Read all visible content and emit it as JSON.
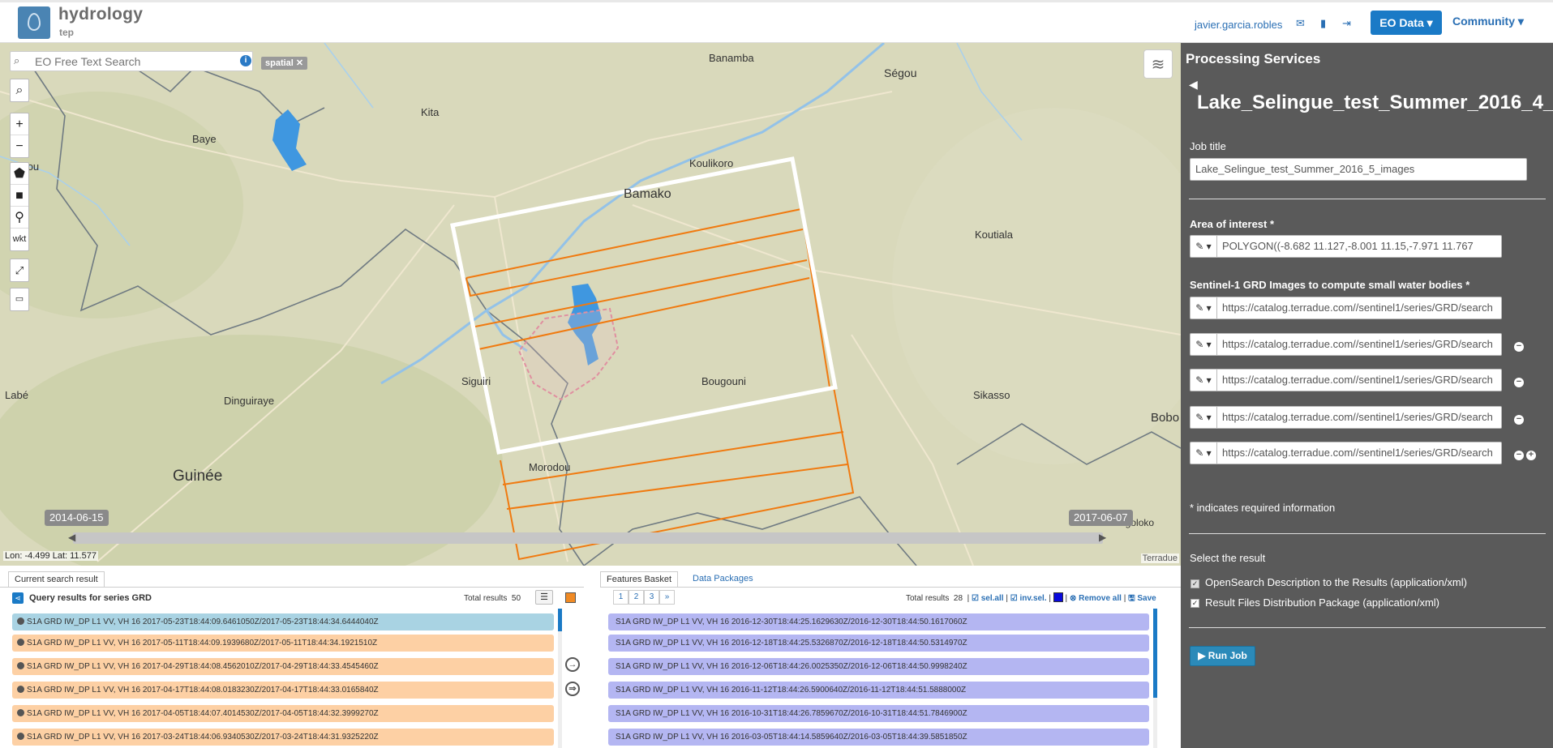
{
  "brand": {
    "title": "hydrology",
    "subtitle": "tep"
  },
  "header": {
    "user": "javier.garcia.robles",
    "eo_data_label": "EO Data",
    "community_label": "Community"
  },
  "map": {
    "search_placeholder": "EO Free Text Search",
    "spatial_tag": "spatial",
    "wkt_label": "wkt",
    "places": {
      "banamba": "Banamba",
      "segou": "Ségou",
      "kita": "Kita",
      "baye": "Baye",
      "koulikoro": "Koulikoro",
      "bamako": "Bamako",
      "koutiala": "Koutiala",
      "bougouni": "Bougouni",
      "siguiri": "Siguiri",
      "dinguiraye": "Dinguiraye",
      "labe": "Labé",
      "sikasso": "Sikasso",
      "bobo": "Bobo",
      "guinee": "Guinée",
      "morodou": "Morodou",
      "niangoloko": "Niangoloko",
      "dougou": "ougou"
    },
    "time_start": "2014-06-15",
    "time_end": "2017-06-07",
    "coords": "Lon: -4.499 Lat: 11.577",
    "attribution": "Terradue"
  },
  "panel": {
    "title": "Processing Services",
    "job_header": "Lake_Selingue_test_Summer_2016_4_",
    "job_title_label": "Job title",
    "job_title_value": "Lake_Selingue_test_Summer_2016_5_images",
    "aoi_label": "Area of interest *",
    "aoi_value": "POLYGON((-8.682 11.127,-8.001 11.15,-7.971 11.767",
    "images_label": "Sentinel-1 GRD Images to compute small water bodies *",
    "image_inputs": [
      "https://catalog.terradue.com//sentinel1/series/GRD/search",
      "https://catalog.terradue.com//sentinel1/series/GRD/search",
      "https://catalog.terradue.com//sentinel1/series/GRD/search",
      "https://catalog.terradue.com//sentinel1/series/GRD/search",
      "https://catalog.terradue.com//sentinel1/series/GRD/search"
    ],
    "required_note": "* indicates required information",
    "select_result_label": "Select the result",
    "result_options": [
      "OpenSearch Description to the Results (application/xml)",
      "Result Files Distribution Package (application/xml)"
    ],
    "run_label": "Run Job"
  },
  "search_results": {
    "tab_label": "Current search result",
    "title": "Query results for series GRD",
    "total_label": "Total results",
    "total": "50",
    "rows": [
      "S1A GRD IW_DP L1 VV, VH 16 2017-05-23T18:44:09.6461050Z/2017-05-23T18:44:34.6444040Z",
      "S1A GRD IW_DP L1 VV, VH 16 2017-05-11T18:44:09.1939680Z/2017-05-11T18:44:34.1921510Z",
      "S1A GRD IW_DP L1 VV, VH 16 2017-04-29T18:44:08.4562010Z/2017-04-29T18:44:33.4545460Z",
      "S1A GRD IW_DP L1 VV, VH 16 2017-04-17T18:44:08.0183230Z/2017-04-17T18:44:33.0165840Z",
      "S1A GRD IW_DP L1 VV, VH 16 2017-04-05T18:44:07.4014530Z/2017-04-05T18:44:32.3999270Z",
      "S1A GRD IW_DP L1 VV, VH 16 2017-03-24T18:44:06.9340530Z/2017-03-24T18:44:31.9325220Z"
    ]
  },
  "basket": {
    "tab_label": "Features Basket",
    "tab2_label": "Data Packages",
    "pages": [
      "1",
      "2",
      "3",
      "»"
    ],
    "total_label": "Total results",
    "total": "28",
    "sel_all": "sel.all",
    "inv_sel": "inv.sel.",
    "remove_all": "Remove all",
    "save": "Save",
    "rows": [
      "S1A GRD IW_DP L1 VV, VH 16 2016-12-30T18:44:25.1629630Z/2016-12-30T18:44:50.1617060Z",
      "S1A GRD IW_DP L1 VV, VH 16 2016-12-18T18:44:25.5326870Z/2016-12-18T18:44:50.5314970Z",
      "S1A GRD IW_DP L1 VV, VH 16 2016-12-06T18:44:26.0025350Z/2016-12-06T18:44:50.9998240Z",
      "S1A GRD IW_DP L1 VV, VH 16 2016-11-12T18:44:26.5900640Z/2016-11-12T18:44:51.5888000Z",
      "S1A GRD IW_DP L1 VV, VH 16 2016-10-31T18:44:26.7859670Z/2016-10-31T18:44:51.7846900Z",
      "S1A GRD IW_DP L1 VV, VH 16 2016-03-05T18:44:14.5859640Z/2016-03-05T18:44:39.5851850Z"
    ]
  },
  "colors": {
    "accent": "#1a7ac6",
    "panel_bg": "#5a5a5a",
    "aoi_orange": "#f07a10",
    "row_orange": "#fdd0a4",
    "row_blue": "#b4b6f2",
    "row_selected": "#a9d3e3"
  }
}
